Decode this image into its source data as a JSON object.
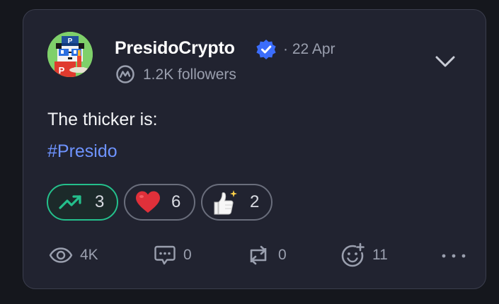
{
  "post": {
    "author": "PresidoCrypto",
    "date": "· 22 Apr",
    "followers": "1.2K followers",
    "text": "The thicker is:",
    "hashtag": "#Presido"
  },
  "reactions": {
    "trending_count": "3",
    "heart_count": "6",
    "thumbs_count": "2"
  },
  "footer": {
    "views": "4K",
    "comments": "0",
    "reposts": "0",
    "emoji_reactions": "11"
  },
  "icons": {
    "verified": "verified-badge-icon",
    "coinmarketcap": "coinmarketcap-icon",
    "menu": "chevron-down-icon",
    "trending": "trending-up-icon",
    "heart": "heart-icon",
    "thumbs": "thumbs-up-icon",
    "views": "eye-icon",
    "comments": "comment-icon",
    "reposts": "repost-icon",
    "add_reaction": "add-reaction-icon",
    "more": "more-icon"
  },
  "colors": {
    "background": "#15171d",
    "card": "#212330",
    "accent_link": "#6e93ff",
    "verified": "#3b6dfb",
    "trending": "#24c08c",
    "heart": "#e0303a"
  }
}
